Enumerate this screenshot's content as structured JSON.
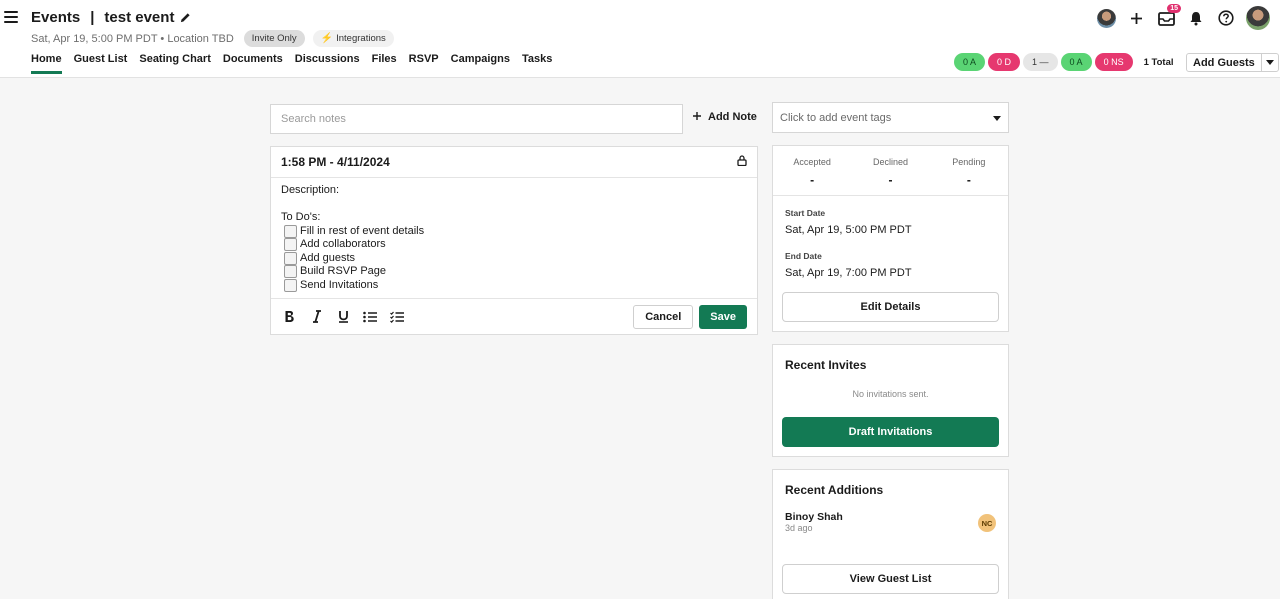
{
  "header": {
    "app_title": "Events",
    "separator": "|",
    "event_title": "test event",
    "subtitle": "Sat, Apr 19, 5:00 PM PDT • Location TBD",
    "badge_invite": "Invite Only",
    "badge_integrations": "Integrations",
    "notification_count": "15",
    "tabs": [
      "Home",
      "Guest List",
      "Seating Chart",
      "Documents",
      "Discussions",
      "Files",
      "RSVP",
      "Campaigns",
      "Tasks"
    ],
    "active_tab": "Home",
    "pills": [
      "0 A",
      "0 D",
      "1 —",
      "0 A",
      "0 NS"
    ],
    "total": "1 Total",
    "add_guests": "Add Guests"
  },
  "notes": {
    "search_placeholder": "Search notes",
    "add_note": "Add Note",
    "note_title": "1:58 PM - 4/11/2024",
    "description_label": "Description:",
    "todo_label": "To Do's:",
    "todos": [
      "Fill in rest of event details",
      "Add collaborators",
      "Add guests",
      "Build RSVP Page",
      "Send Invitations"
    ],
    "cancel": "Cancel",
    "save": "Save"
  },
  "sidebar": {
    "tags_placeholder": "Click to add event tags",
    "stats": [
      {
        "label": "Accepted",
        "value": "-"
      },
      {
        "label": "Declined",
        "value": "-"
      },
      {
        "label": "Pending",
        "value": "-"
      }
    ],
    "start_label": "Start Date",
    "start_value": "Sat, Apr 19, 5:00 PM PDT",
    "end_label": "End Date",
    "end_value": "Sat, Apr 19, 7:00 PM PDT",
    "edit_details": "Edit Details",
    "recent_invites_title": "Recent Invites",
    "no_invites": "No invitations sent.",
    "draft_invitations": "Draft Invitations",
    "recent_additions_title": "Recent Additions",
    "guest_name": "Binoy Shah",
    "guest_time": "3d ago",
    "guest_initials": "NC",
    "view_guest_list": "View Guest List"
  },
  "colors": {
    "accent": "#137a54",
    "pill_green": "#5ad474",
    "pill_red": "#e6386f",
    "badge": "#e0306e"
  }
}
